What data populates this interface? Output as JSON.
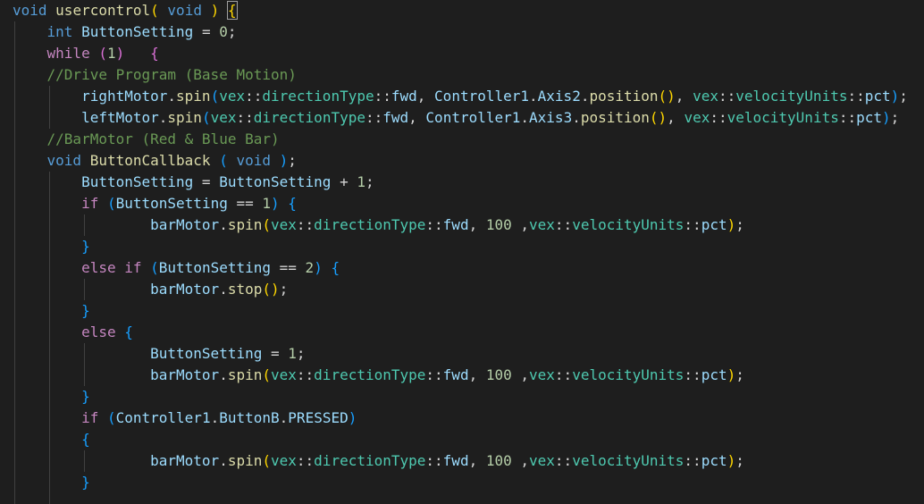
{
  "editor": {
    "lines": [
      {
        "tokens": [
          {
            "t": "void",
            "c": "kw"
          },
          {
            "t": " "
          },
          {
            "t": "usercontrol",
            "c": "fn"
          },
          {
            "t": "(",
            "c": "p1"
          },
          {
            "t": " "
          },
          {
            "t": "void",
            "c": "kw"
          },
          {
            "t": " "
          },
          {
            "t": ")",
            "c": "p1"
          },
          {
            "t": " "
          },
          {
            "t": "{",
            "c": "p1 cursorbox"
          }
        ]
      },
      {
        "tokens": [
          {
            "t": "    "
          },
          {
            "t": "int",
            "c": "kw"
          },
          {
            "t": " "
          },
          {
            "t": "ButtonSetting",
            "c": "var"
          },
          {
            "t": " = "
          },
          {
            "t": "0",
            "c": "num"
          },
          {
            "t": ";"
          }
        ]
      },
      {
        "tokens": [
          {
            "t": "    "
          },
          {
            "t": "while",
            "c": "ctl"
          },
          {
            "t": " "
          },
          {
            "t": "(",
            "c": "p2"
          },
          {
            "t": "1",
            "c": "num"
          },
          {
            "t": ")",
            "c": "p2"
          },
          {
            "t": "   "
          },
          {
            "t": "{",
            "c": "p2"
          }
        ]
      },
      {
        "tokens": [
          {
            "t": "    "
          },
          {
            "t": "//Drive Program (Base Motion)",
            "c": "cmt"
          }
        ]
      },
      {
        "tokens": [
          {
            "t": "        "
          },
          {
            "t": "rightMotor",
            "c": "var"
          },
          {
            "t": "."
          },
          {
            "t": "spin",
            "c": "fn"
          },
          {
            "t": "(",
            "c": "p3"
          },
          {
            "t": "vex",
            "c": "typ"
          },
          {
            "t": "::"
          },
          {
            "t": "directionType",
            "c": "typ"
          },
          {
            "t": "::"
          },
          {
            "t": "fwd",
            "c": "var"
          },
          {
            "t": ", "
          },
          {
            "t": "Controller1",
            "c": "var"
          },
          {
            "t": "."
          },
          {
            "t": "Axis2",
            "c": "var"
          },
          {
            "t": "."
          },
          {
            "t": "position",
            "c": "fn"
          },
          {
            "t": "()",
            "c": "p1"
          },
          {
            "t": ", "
          },
          {
            "t": "vex",
            "c": "typ"
          },
          {
            "t": "::"
          },
          {
            "t": "velocityUnits",
            "c": "typ"
          },
          {
            "t": "::"
          },
          {
            "t": "pct",
            "c": "var"
          },
          {
            "t": ")",
            "c": "p3"
          },
          {
            "t": ";"
          }
        ]
      },
      {
        "tokens": [
          {
            "t": "        "
          },
          {
            "t": "leftMotor",
            "c": "var"
          },
          {
            "t": "."
          },
          {
            "t": "spin",
            "c": "fn"
          },
          {
            "t": "(",
            "c": "p3"
          },
          {
            "t": "vex",
            "c": "typ"
          },
          {
            "t": "::"
          },
          {
            "t": "directionType",
            "c": "typ"
          },
          {
            "t": "::"
          },
          {
            "t": "fwd",
            "c": "var"
          },
          {
            "t": ", "
          },
          {
            "t": "Controller1",
            "c": "var"
          },
          {
            "t": "."
          },
          {
            "t": "Axis3",
            "c": "var"
          },
          {
            "t": "."
          },
          {
            "t": "position",
            "c": "fn"
          },
          {
            "t": "()",
            "c": "p1"
          },
          {
            "t": ", "
          },
          {
            "t": "vex",
            "c": "typ"
          },
          {
            "t": "::"
          },
          {
            "t": "velocityUnits",
            "c": "typ"
          },
          {
            "t": "::"
          },
          {
            "t": "pct",
            "c": "var"
          },
          {
            "t": ")",
            "c": "p3"
          },
          {
            "t": ";"
          }
        ]
      },
      {
        "tokens": [
          {
            "t": "    "
          },
          {
            "t": "//BarMotor (Red & Blue Bar)",
            "c": "cmt"
          }
        ]
      },
      {
        "tokens": [
          {
            "t": "    "
          },
          {
            "t": "void",
            "c": "kw"
          },
          {
            "t": " "
          },
          {
            "t": "ButtonCallback",
            "c": "fn"
          },
          {
            "t": " "
          },
          {
            "t": "(",
            "c": "p3"
          },
          {
            "t": " "
          },
          {
            "t": "void",
            "c": "kw"
          },
          {
            "t": " "
          },
          {
            "t": ")",
            "c": "p3"
          },
          {
            "t": ";"
          }
        ]
      },
      {
        "tokens": [
          {
            "t": "        "
          },
          {
            "t": "ButtonSetting",
            "c": "var"
          },
          {
            "t": " = "
          },
          {
            "t": "ButtonSetting",
            "c": "var"
          },
          {
            "t": " + "
          },
          {
            "t": "1",
            "c": "num"
          },
          {
            "t": ";"
          }
        ]
      },
      {
        "tokens": [
          {
            "t": "        "
          },
          {
            "t": "if",
            "c": "ctl"
          },
          {
            "t": " "
          },
          {
            "t": "(",
            "c": "p3"
          },
          {
            "t": "ButtonSetting",
            "c": "var"
          },
          {
            "t": " == "
          },
          {
            "t": "1",
            "c": "num"
          },
          {
            "t": ")",
            "c": "p3"
          },
          {
            "t": " "
          },
          {
            "t": "{",
            "c": "p3"
          }
        ]
      },
      {
        "tokens": [
          {
            "t": "                "
          },
          {
            "t": "barMotor",
            "c": "var"
          },
          {
            "t": "."
          },
          {
            "t": "spin",
            "c": "fn"
          },
          {
            "t": "(",
            "c": "p1"
          },
          {
            "t": "vex",
            "c": "typ"
          },
          {
            "t": "::"
          },
          {
            "t": "directionType",
            "c": "typ"
          },
          {
            "t": "::"
          },
          {
            "t": "fwd",
            "c": "var"
          },
          {
            "t": ", "
          },
          {
            "t": "100",
            "c": "num"
          },
          {
            "t": " ,"
          },
          {
            "t": "vex",
            "c": "typ"
          },
          {
            "t": "::"
          },
          {
            "t": "velocityUnits",
            "c": "typ"
          },
          {
            "t": "::"
          },
          {
            "t": "pct",
            "c": "var"
          },
          {
            "t": ")",
            "c": "p1"
          },
          {
            "t": ";"
          }
        ]
      },
      {
        "tokens": [
          {
            "t": "        "
          },
          {
            "t": "}",
            "c": "p3"
          }
        ]
      },
      {
        "tokens": [
          {
            "t": "        "
          },
          {
            "t": "else",
            "c": "ctl"
          },
          {
            "t": " "
          },
          {
            "t": "if",
            "c": "ctl"
          },
          {
            "t": " "
          },
          {
            "t": "(",
            "c": "p3"
          },
          {
            "t": "ButtonSetting",
            "c": "var"
          },
          {
            "t": " == "
          },
          {
            "t": "2",
            "c": "num"
          },
          {
            "t": ")",
            "c": "p3"
          },
          {
            "t": " "
          },
          {
            "t": "{",
            "c": "p3"
          }
        ]
      },
      {
        "tokens": [
          {
            "t": "                "
          },
          {
            "t": "barMotor",
            "c": "var"
          },
          {
            "t": "."
          },
          {
            "t": "stop",
            "c": "fn"
          },
          {
            "t": "()",
            "c": "p1"
          },
          {
            "t": ";"
          }
        ]
      },
      {
        "tokens": [
          {
            "t": "        "
          },
          {
            "t": "}",
            "c": "p3"
          }
        ]
      },
      {
        "tokens": [
          {
            "t": "        "
          },
          {
            "t": "else",
            "c": "ctl"
          },
          {
            "t": " "
          },
          {
            "t": "{",
            "c": "p3"
          }
        ]
      },
      {
        "tokens": [
          {
            "t": "                "
          },
          {
            "t": "ButtonSetting",
            "c": "var"
          },
          {
            "t": " = "
          },
          {
            "t": "1",
            "c": "num"
          },
          {
            "t": ";"
          }
        ]
      },
      {
        "tokens": [
          {
            "t": "                "
          },
          {
            "t": "barMotor",
            "c": "var"
          },
          {
            "t": "."
          },
          {
            "t": "spin",
            "c": "fn"
          },
          {
            "t": "(",
            "c": "p1"
          },
          {
            "t": "vex",
            "c": "typ"
          },
          {
            "t": "::"
          },
          {
            "t": "directionType",
            "c": "typ"
          },
          {
            "t": "::"
          },
          {
            "t": "fwd",
            "c": "var"
          },
          {
            "t": ", "
          },
          {
            "t": "100",
            "c": "num"
          },
          {
            "t": " ,"
          },
          {
            "t": "vex",
            "c": "typ"
          },
          {
            "t": "::"
          },
          {
            "t": "velocityUnits",
            "c": "typ"
          },
          {
            "t": "::"
          },
          {
            "t": "pct",
            "c": "var"
          },
          {
            "t": ")",
            "c": "p1"
          },
          {
            "t": ";"
          }
        ]
      },
      {
        "tokens": [
          {
            "t": "        "
          },
          {
            "t": "}",
            "c": "p3"
          }
        ]
      },
      {
        "tokens": [
          {
            "t": "        "
          },
          {
            "t": "if",
            "c": "ctl"
          },
          {
            "t": " "
          },
          {
            "t": "(",
            "c": "p3"
          },
          {
            "t": "Controller1",
            "c": "var"
          },
          {
            "t": "."
          },
          {
            "t": "ButtonB",
            "c": "var"
          },
          {
            "t": "."
          },
          {
            "t": "PRESSED",
            "c": "var"
          },
          {
            "t": ")",
            "c": "p3"
          }
        ]
      },
      {
        "tokens": [
          {
            "t": "        "
          },
          {
            "t": "{",
            "c": "p3"
          }
        ]
      },
      {
        "tokens": [
          {
            "t": "                "
          },
          {
            "t": "barMotor",
            "c": "var"
          },
          {
            "t": "."
          },
          {
            "t": "spin",
            "c": "fn"
          },
          {
            "t": "(",
            "c": "p1"
          },
          {
            "t": "vex",
            "c": "typ"
          },
          {
            "t": "::"
          },
          {
            "t": "directionType",
            "c": "typ"
          },
          {
            "t": "::"
          },
          {
            "t": "fwd",
            "c": "var"
          },
          {
            "t": ", "
          },
          {
            "t": "100",
            "c": "num"
          },
          {
            "t": " ,"
          },
          {
            "t": "vex",
            "c": "typ"
          },
          {
            "t": "::"
          },
          {
            "t": "velocityUnits",
            "c": "typ"
          },
          {
            "t": "::"
          },
          {
            "t": "pct",
            "c": "var"
          },
          {
            "t": ")",
            "c": "p1"
          },
          {
            "t": ";"
          }
        ]
      },
      {
        "tokens": [
          {
            "t": "        "
          },
          {
            "t": "}",
            "c": "p3"
          }
        ]
      }
    ]
  },
  "colors": {
    "background": "#1e1e1e",
    "keyword": "#569cd6",
    "control": "#c586c0",
    "function": "#dcdcaa",
    "variable": "#9cdcfe",
    "number": "#b5cea8",
    "comment": "#6a9955",
    "namespace": "#4ec9b0",
    "bracket_1": "#ffd700",
    "bracket_2": "#da70d6",
    "bracket_3": "#179fff"
  }
}
